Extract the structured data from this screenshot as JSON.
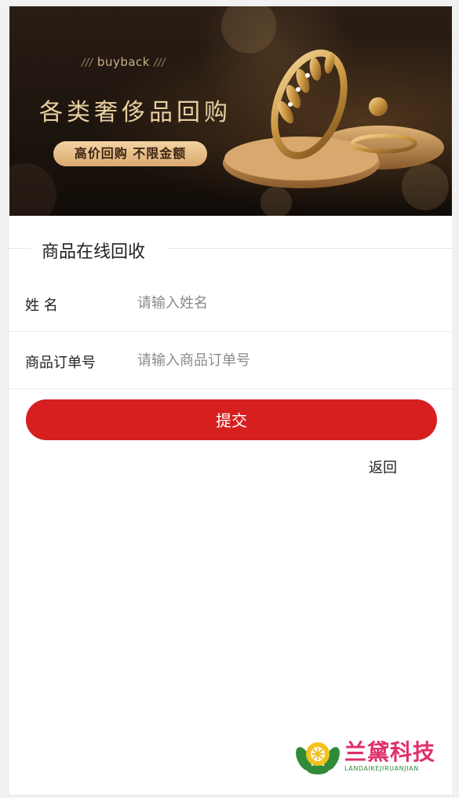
{
  "banner": {
    "small_text": "buyback",
    "slashes": "///",
    "title": "各类奢侈品回购",
    "pill_text": "高价回购  不限金额"
  },
  "section": {
    "title": "商品在线回收"
  },
  "form": {
    "name_label": "姓 名",
    "name_placeholder": "请输入姓名",
    "order_label": "商品订单号",
    "order_placeholder": "请输入商品订单号",
    "submit_label": "提交",
    "back_label": "返回"
  },
  "logo": {
    "name": "兰黛科技",
    "subtitle": "LANDAIKEJIRUANJIAN"
  },
  "colors": {
    "accent": "#d71f1f",
    "logo_pink": "#e0306a",
    "logo_green": "#2f8a3a",
    "banner_gold": "#e9cfa2"
  }
}
